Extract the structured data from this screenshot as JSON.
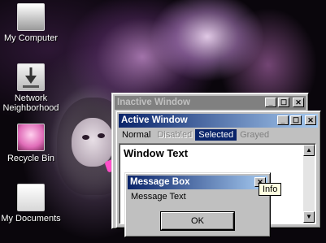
{
  "desktop_icons": [
    {
      "label": "My Computer",
      "icon": "my-computer-icon"
    },
    {
      "label": "Network Neighborhood",
      "icon": "network-neighborhood-icon"
    },
    {
      "label": "Recycle Bin",
      "icon": "recycle-bin-icon"
    },
    {
      "label": "My Documents",
      "icon": "my-documents-icon"
    }
  ],
  "inactive_window": {
    "title": "Inactive Window"
  },
  "active_window": {
    "title": "Active Window",
    "menu": {
      "normal": "Normal",
      "disabled": "Disabled",
      "selected": "Selected",
      "grayed": "Grayed"
    },
    "body_text": "Window Text"
  },
  "message_box": {
    "title": "Message Box",
    "text": "Message Text",
    "ok_label": "OK"
  },
  "tooltip": "Info",
  "colors": {
    "active_title_start": "#0a246a",
    "active_title_end": "#a6caf0",
    "inactive_title": "#808080",
    "face": "#c0c0c0",
    "tooltip_bg": "#ffffe1"
  }
}
